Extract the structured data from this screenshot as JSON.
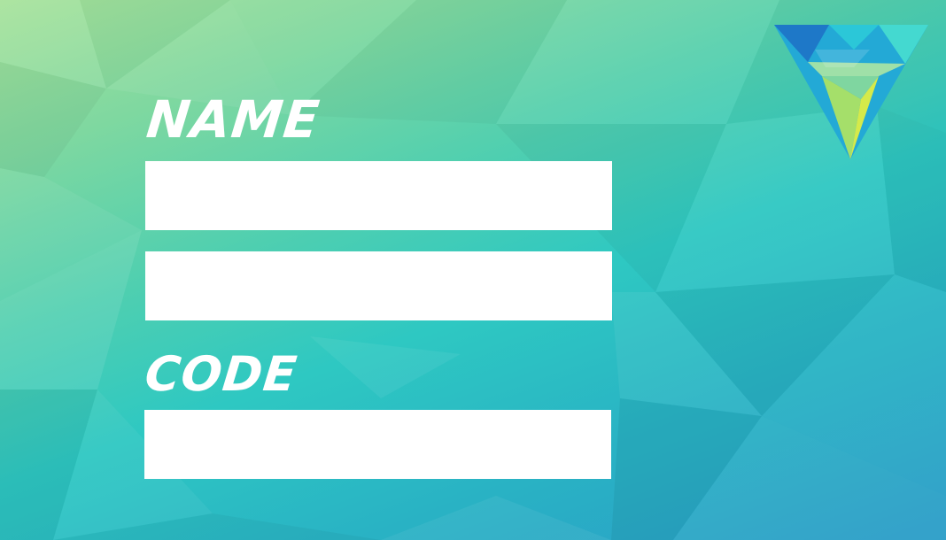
{
  "card": {
    "name_label": "NAME",
    "code_label": "CODE",
    "name_field_line1": {
      "value": "",
      "placeholder": ""
    },
    "name_field_line2": {
      "value": "",
      "placeholder": ""
    },
    "code_field": {
      "value": "",
      "placeholder": ""
    }
  },
  "logo": {
    "icon": "triangle-v-logo-icon"
  },
  "colors": {
    "background_top": "#a6e29a",
    "background_mid": "#2ec8c2",
    "background_bottom": "#2a9cc8",
    "label": "#ffffff",
    "field": "#ffffff"
  }
}
